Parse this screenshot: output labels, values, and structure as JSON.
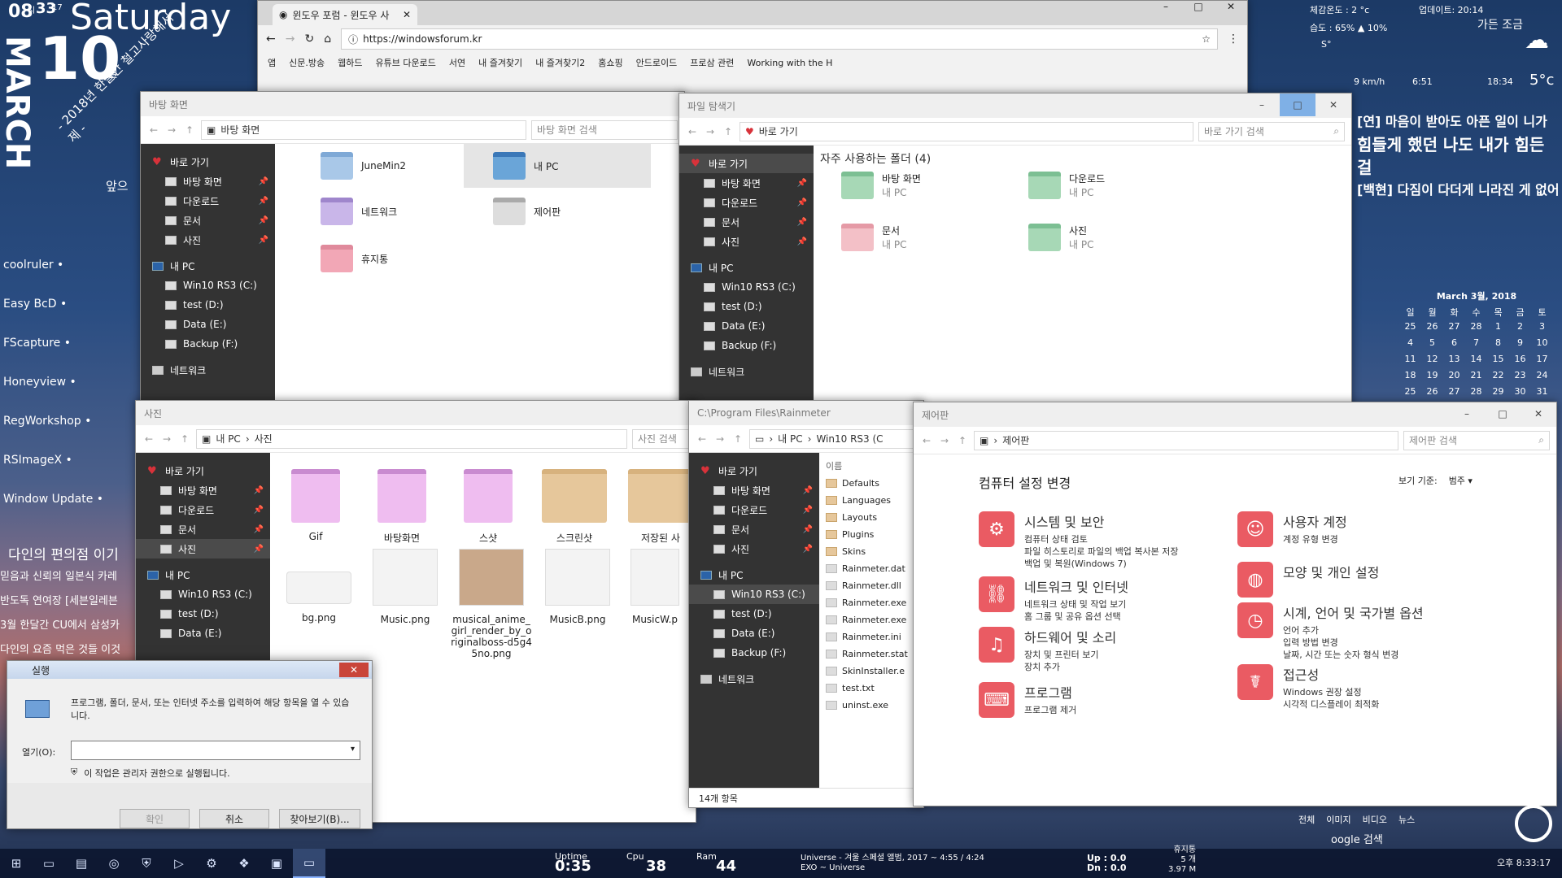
{
  "desktop": {
    "hour": "08",
    "hour_unit": "시",
    "minute": "33",
    "minute_unit": "분",
    "sec": "17",
    "weekday": "Saturday",
    "day": "10",
    "day_unit": "월",
    "month": "MARCH",
    "note": "- 2018년 한달간 철고사랑해서 제 -",
    "side_text": "앞으",
    "launchers": [
      "coolruler •",
      "Easy BcD •",
      "FScapture •",
      "Honeyview •",
      "RegWorkshop •",
      "RSImageX •",
      "Window Update •"
    ],
    "news_title": "다인의 편의점 이기",
    "news": [
      "믿음과 신뢰의 일본식 카레",
      "반도독 연여장 [세븐일레븐",
      "3월 한달간 CU에서 삼성카",
      "다인의 요즘 먹은 것들 이것"
    ]
  },
  "weather": {
    "line1": "체감온도 : 2 °c",
    "line2": "습도 : 65% ▲ 10%",
    "line3": "S°",
    "wind": "9 km/h",
    "uv": "업데이트: 20:14",
    "temp": "5°c",
    "city": "가든 조금",
    "sunrise": "6:51",
    "sunset": "18:34"
  },
  "quote": [
    "[연] 마음이 받아도 아픈 일이 니가",
    "힘들게 했던 나도 내가 힘든 걸",
    "[백현] 다짐이 다더게 니라진 게 없어"
  ],
  "calendar": {
    "title": "March 3월, 2018",
    "days": [
      "일",
      "월",
      "화",
      "수",
      "목",
      "금",
      "토"
    ],
    "rows": [
      [
        "25",
        "26",
        "27",
        "28",
        "1",
        "2",
        "3"
      ],
      [
        "4",
        "5",
        "6",
        "7",
        "8",
        "9",
        "10"
      ],
      [
        "11",
        "12",
        "13",
        "14",
        "15",
        "16",
        "17"
      ],
      [
        "18",
        "19",
        "20",
        "21",
        "22",
        "23",
        "24"
      ],
      [
        "25",
        "26",
        "27",
        "28",
        "29",
        "30",
        "31"
      ]
    ]
  },
  "browser": {
    "tab": "윈도우 포럼 - 윈도우 사",
    "url": "https://windowsforum.kr",
    "bookmarks": [
      "앱",
      "신문.방송",
      "웹하드",
      "유튜브 다운로드",
      "서연",
      "내 즐겨찾기",
      "내 즐겨찾기2",
      "홈쇼핑",
      "안드로이드",
      "프로삼 관련",
      "Working with the H"
    ]
  },
  "nav_common": {
    "quick": "바로 가기",
    "desktop": "바탕 화면",
    "downloads": "다운로드",
    "docs": "문서",
    "pics": "사진",
    "mypc": "내 PC",
    "c": "Win10 RS3 (C:)",
    "d": "test (D:)",
    "e": "Data (E:)",
    "f": "Backup (F:)",
    "net": "네트워크"
  },
  "win_desktop": {
    "title": "바탕 화면",
    "path": "바탕 화면",
    "search": "바탕 화면 검색",
    "items": [
      "JuneMin2",
      "내 PC",
      "네트워크",
      "제어판",
      "휴지통"
    ]
  },
  "win_explorer": {
    "title": "파일 탐색기",
    "path": "바로 가기",
    "search": "바로 가기 검색",
    "group": "자주 사용하는 폴더 (4)",
    "items": [
      {
        "name": "바탕 화면",
        "sub": "내 PC"
      },
      {
        "name": "다운로드",
        "sub": "내 PC"
      },
      {
        "name": "문서",
        "sub": "내 PC"
      },
      {
        "name": "사진",
        "sub": "내 PC"
      }
    ]
  },
  "win_photos": {
    "title": "사진",
    "path1": "내 PC",
    "path2": "사진",
    "search": "사진 검색",
    "folders": [
      "Gif",
      "바탕화면",
      "스샷",
      "스크린샷",
      "저장된 사"
    ],
    "files": [
      "bg.png",
      "Music.png",
      "musical_anime_girl_render_by_originalboss-d5g45no.png",
      "MusicB.png",
      "MusicW.p"
    ]
  },
  "win_rain": {
    "title": "C:\\Program Files\\Rainmeter",
    "path1": "내 PC",
    "path2": "Win10 RS3 (C",
    "col": "이름",
    "files": [
      "Defaults",
      "Languages",
      "Layouts",
      "Plugins",
      "Skins",
      "Rainmeter.dat",
      "Rainmeter.dll",
      "Rainmeter.exe",
      "Rainmeter.exe",
      "Rainmeter.ini",
      "Rainmeter.stat",
      "SkinInstaller.e",
      "test.txt",
      "uninst.exe"
    ],
    "count": "14개 항목"
  },
  "win_cp": {
    "title": "제어판",
    "path": "제어판",
    "search": "제어판 검색",
    "heading": "컴퓨터 설정 변경",
    "view_label": "보기 기준:",
    "view_value": "범주 ▾",
    "left": [
      {
        "t": "시스템 및 보안",
        "s": [
          "컴퓨터 상태 검토",
          "파일 히스토리로 파일의 백업 복사본 저장",
          "백업 및 복원(Windows 7)"
        ]
      },
      {
        "t": "네트워크 및 인터넷",
        "s": [
          "네트워크 상태 및 작업 보기",
          "홈 그룹 및 공유 옵션 선택"
        ]
      },
      {
        "t": "하드웨어 및 소리",
        "s": [
          "장치 및 프린터 보기",
          "장치 추가"
        ]
      },
      {
        "t": "프로그램",
        "s": [
          "프로그램 제거"
        ]
      }
    ],
    "right": [
      {
        "t": "사용자 계정",
        "s": [
          "계정 유형 변경"
        ]
      },
      {
        "t": "모양 및 개인 설정",
        "s": []
      },
      {
        "t": "시계, 언어 및 국가별 옵션",
        "s": [
          "언어 추가",
          "입력 방법 변경",
          "날짜, 시간 또는 숫자 형식 변경"
        ]
      },
      {
        "t": "접근성",
        "s": [
          "Windows 권장 설정",
          "시각적 디스플레이 최적화"
        ]
      }
    ]
  },
  "run": {
    "title": "실행",
    "desc": "프로그램, 폴더, 문서, 또는 인터넷 주소를 입력하여 해당 항목을 열 수 있습니다.",
    "open_label": "열기(O):",
    "admin": "이 작업은 관리자 권한으로 실행됩니다.",
    "ok": "확인",
    "cancel": "취소",
    "browse": "찾아보기(B)..."
  },
  "taskbar": {
    "uptime_label": "Uptime",
    "uptime": "0:35",
    "cpu_label": "Cpu",
    "cpu": "38",
    "ram_label": "Ram",
    "ram": "44",
    "song": "Universe - 겨울 스페셜 앨범, 2017 ~ 4:55 / 4:24",
    "artist": "EXO ~ Universe",
    "up": "Up : 0.0",
    "dn": "Dn : 0.0",
    "bin_label": "휴지통",
    "bin_count": "5 개",
    "bin_size": "3.97 M",
    "clock": "오후 8:33:17",
    "search": "oogle 검색",
    "links": [
      "전체",
      "이미지",
      "비디오",
      "뉴스"
    ]
  }
}
